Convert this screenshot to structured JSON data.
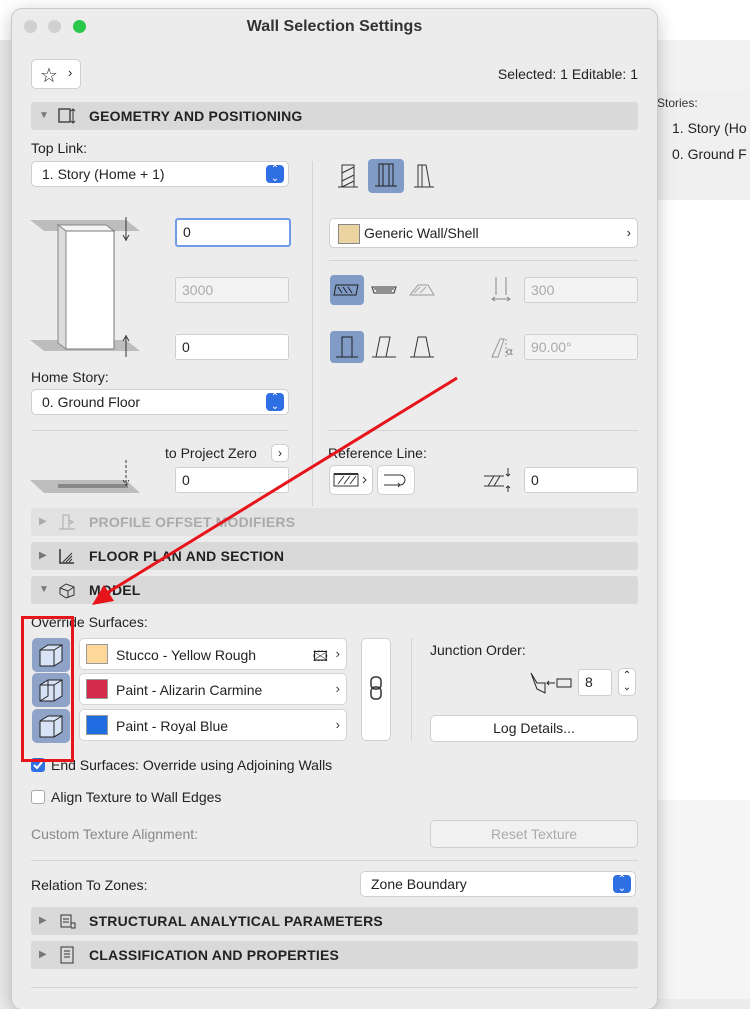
{
  "background_app": {
    "stories_label": "Stories:",
    "stories": [
      "1. Story (Ho",
      "0. Ground F"
    ]
  },
  "window": {
    "title": "Wall Selection Settings",
    "selected_info": "Selected: 1 Editable: 1"
  },
  "sections": {
    "geometry": "GEOMETRY AND POSITIONING",
    "profile_offset": "PROFILE OFFSET MODIFIERS",
    "floor_plan": "FLOOR PLAN AND SECTION",
    "model": "MODEL",
    "structural": "STRUCTURAL ANALYTICAL PARAMETERS",
    "classification": "CLASSIFICATION AND PROPERTIES"
  },
  "geometry": {
    "top_link_label": "Top Link:",
    "top_link_value": "1. Story (Home + 1)",
    "top_offset": "0",
    "height": "3000",
    "base_offset": "0",
    "home_story_label": "Home Story:",
    "home_story_value": "0. Ground Floor",
    "to_project_zero_label": "to Project Zero",
    "project_zero_value": "0",
    "building_material": "Generic Wall/Shell",
    "thickness": "300",
    "slant_angle": "90.00°",
    "reference_line_label": "Reference Line:",
    "reference_offset": "0"
  },
  "model": {
    "override_label": "Override Surfaces:",
    "surfaces": [
      {
        "name": "Stucco - Yellow Rough",
        "color": "#fdd89a"
      },
      {
        "name": "Paint - Alizarin Carmine",
        "color": "#d62a4a"
      },
      {
        "name": "Paint - Royal Blue",
        "color": "#1f6de0"
      }
    ],
    "junction_label": "Junction Order:",
    "junction_value": "8",
    "log_details": "Log Details...",
    "end_surfaces_label": "End Surfaces: Override using Adjoining Walls",
    "align_texture_label": "Align Texture to Wall Edges",
    "custom_texture_label": "Custom Texture Alignment:",
    "reset_texture": "Reset Texture",
    "relation_label": "Relation To Zones:",
    "relation_value": "Zone Boundary"
  },
  "colors": {
    "annotation": "#e8141b",
    "accent": "#2f6fe4",
    "active_icon": "#7f9bc6"
  }
}
